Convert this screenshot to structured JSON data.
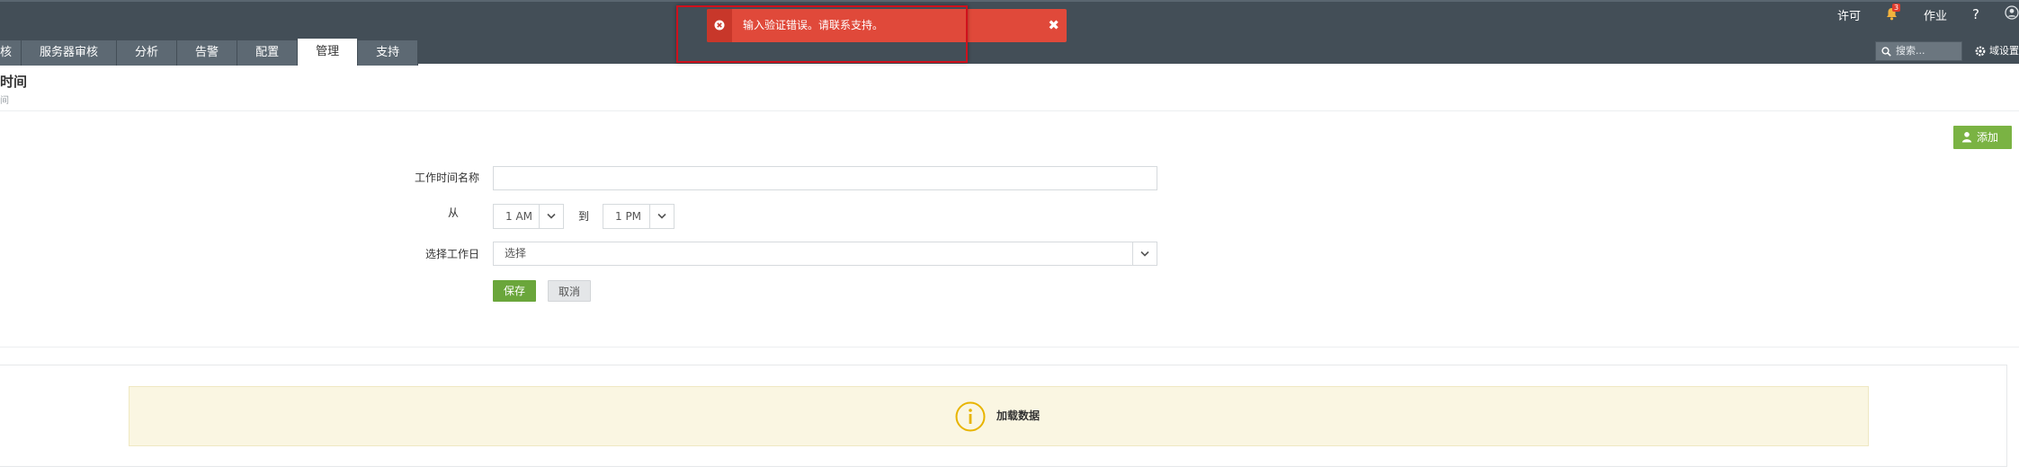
{
  "header": {
    "tabs": [
      {
        "label": "核"
      },
      {
        "label": "服务器审核"
      },
      {
        "label": "分析"
      },
      {
        "label": "告警"
      },
      {
        "label": "配置"
      },
      {
        "label": "管理",
        "active": true
      },
      {
        "label": "支持"
      }
    ],
    "top_links": {
      "license": "许可",
      "notification_count": "3",
      "jobs": "作业",
      "help": "?"
    },
    "search_placeholder": "搜索...",
    "domain_settings": "域设置"
  },
  "toast": {
    "type": "error",
    "message": "输入验证错误。请联系支持。",
    "close": "✖"
  },
  "page": {
    "title": "时间",
    "subtitle": "间"
  },
  "add_button": "添加",
  "form": {
    "name_label": "工作时间名称",
    "name_value": "",
    "from_label": "从",
    "from_value": "1 AM",
    "to_label": "到",
    "to_value": "1 PM",
    "workday_label": "选择工作日",
    "workday_value": "选择",
    "save": "保存",
    "cancel": "取消"
  },
  "loading": {
    "text": "加载数据"
  },
  "colors": {
    "topbar": "#434e57",
    "tab": "#5d6973",
    "error": "#e0493a",
    "accent_green": "#7ab343",
    "notice_bg": "#faf6e2",
    "info_icon": "#e8b400"
  },
  "icons": [
    "bell-icon",
    "help-icon",
    "user-icon",
    "search-icon",
    "gear-icon",
    "error-icon",
    "close-icon",
    "add-user-icon",
    "chevron-down-icon",
    "info-icon"
  ]
}
